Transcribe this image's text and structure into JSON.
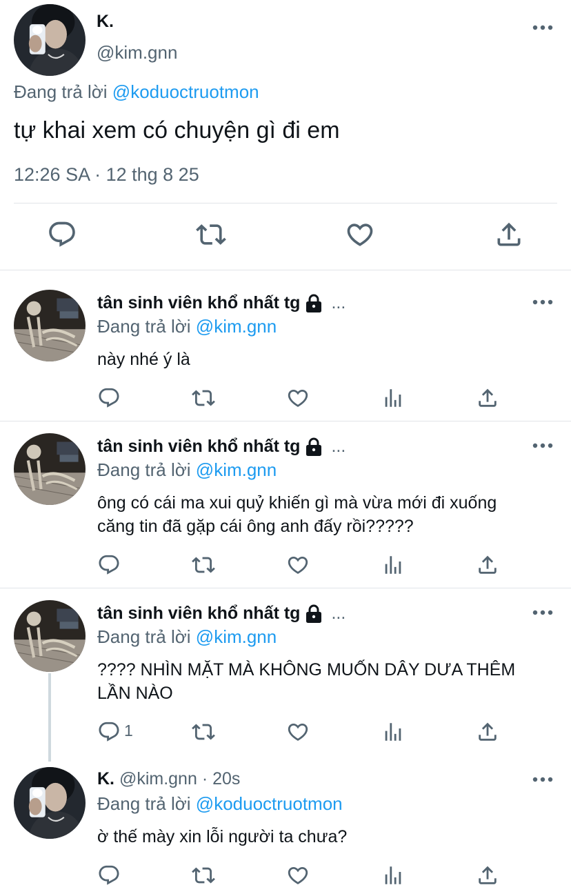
{
  "main_tweet": {
    "display_name": "K.",
    "handle": "@kim.gnn",
    "replying_prefix": "Đang trả lời",
    "replying_to": "@koduoctruotmon",
    "text": "tự khai xem có chuyện gì đi em",
    "timestamp": "12:26 SA · 12 thg 8 25",
    "avatar_icon": "profile-photo-selfie"
  },
  "replies": [
    {
      "display_name": "tân sinh viên khổ nhất tg",
      "protected_icon": "lock-icon",
      "overflow": "...",
      "replying_prefix": "Đang trả lời",
      "replying_to": "@kim.gnn",
      "text": "này nhé ý là",
      "avatar_icon": "profile-photo-skeleton"
    },
    {
      "display_name": "tân sinh viên khổ nhất tg",
      "protected_icon": "lock-icon",
      "overflow": "...",
      "replying_prefix": "Đang trả lời",
      "replying_to": "@kim.gnn",
      "text": "ông có cái ma xui quỷ khiến gì mà vừa mới đi xuống căng tin đã gặp cái ông anh đấy rồi?????",
      "avatar_icon": "profile-photo-skeleton"
    },
    {
      "display_name": "tân sinh viên khổ nhất tg",
      "protected_icon": "lock-icon",
      "overflow": "...",
      "replying_prefix": "Đang trả lời",
      "replying_to": "@kim.gnn",
      "text": "???? NHÌN MẶT MÀ KHÔNG MUỐN DÂY DƯA THÊM LẦN NÀO",
      "reply_count": "1",
      "avatar_icon": "profile-photo-skeleton"
    },
    {
      "display_name": "K.",
      "handle_time": "@kim.gnn · 20s",
      "replying_prefix": "Đang trả lời",
      "replying_to": "@koduoctruotmon",
      "text": "ờ thế mày xin lỗi người ta chưa?",
      "avatar_icon": "profile-photo-selfie"
    }
  ],
  "icons": {
    "reply": "reply-icon",
    "retweet": "retweet-icon",
    "like": "like-icon",
    "views": "views-icon",
    "share": "share-icon",
    "more": "more-icon"
  },
  "colors": {
    "link": "#1d9bf0",
    "muted": "#536471",
    "text": "#0f1419",
    "divider": "#e1e4e8"
  }
}
